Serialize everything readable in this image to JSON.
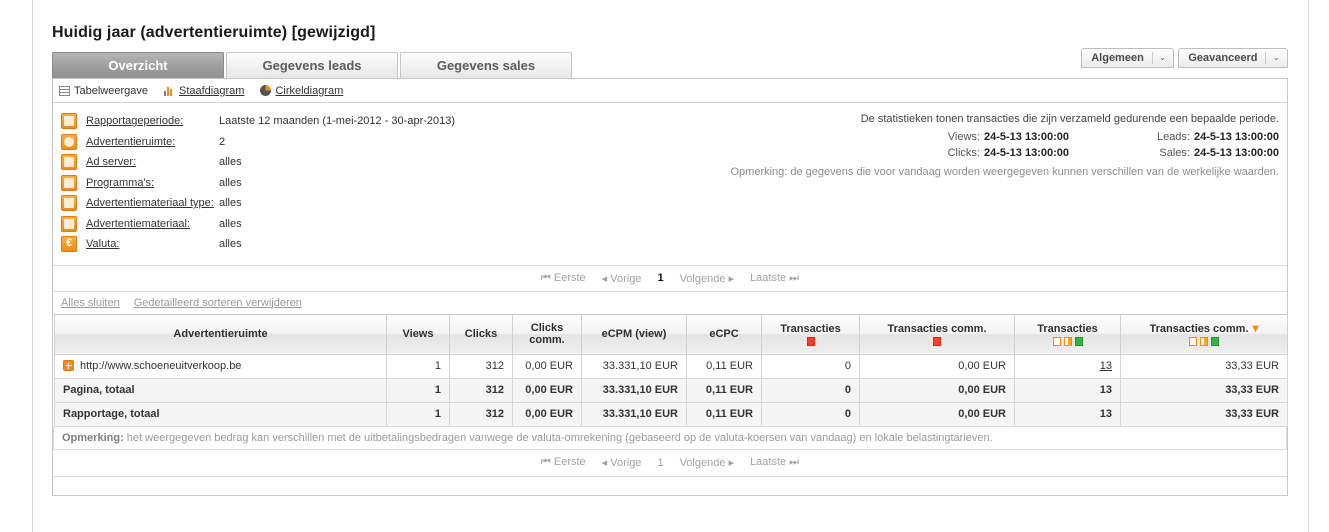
{
  "page": {
    "title": "Huidig jaar (advertentieruimte) [gewijzigd]"
  },
  "top_buttons": [
    {
      "label": "Algemeen",
      "arrow": "⌄"
    },
    {
      "label": "Geavanceerd",
      "arrow": "⌄"
    }
  ],
  "tabs": [
    {
      "label": "Overzicht",
      "active": true
    },
    {
      "label": "Gegevens leads",
      "active": false
    },
    {
      "label": "Gegevens sales",
      "active": false
    }
  ],
  "viewbar": [
    {
      "label": "Tabelweergave",
      "icon": "table-view-icon",
      "link": false
    },
    {
      "label": "Staafdiagram",
      "icon": "bar-chart-icon",
      "link": true
    },
    {
      "label": "Cirkeldiagram",
      "icon": "pie-chart-icon",
      "link": true
    }
  ],
  "filters": [
    {
      "icon": "calendar-icon",
      "label": "Rapportageperiode:",
      "value": "Laatste 12 maanden (1-mei-2012 - 30-apr-2013)"
    },
    {
      "icon": "ad-space-icon",
      "label": "Advertentieruimte:",
      "value": "2"
    },
    {
      "icon": "ad-server-icon",
      "label": "Ad server:",
      "value": "alles"
    },
    {
      "icon": "program-icon",
      "label": "Programma's:",
      "value": "alles"
    },
    {
      "icon": "creative-type-icon",
      "label": "Advertentiemateriaal type:",
      "value": "alles"
    },
    {
      "icon": "creative-icon",
      "label": "Advertentiemateriaal:",
      "value": "alles"
    },
    {
      "icon": "currency-icon",
      "label": "Valuta:",
      "value": "alles"
    }
  ],
  "info": {
    "headline": "De statistieken tonen transacties die zijn verzameld gedurende een bepaalde periode.",
    "stats": [
      {
        "label": "Views:",
        "value": "24-5-13 13:00:00"
      },
      {
        "label": "Leads:",
        "value": "24-5-13 13:00:00"
      },
      {
        "label": "Clicks:",
        "value": "24-5-13 13:00:00"
      },
      {
        "label": "Sales:",
        "value": "24-5-13 13:00:00"
      }
    ],
    "note": "Opmerking: de gegevens die voor vandaag worden weergegeven kunnen verschillen van de werkelijke waarden."
  },
  "pager": {
    "first": "Eerste",
    "previous": "Vorige",
    "current": "1",
    "next": "Volgende",
    "last": "Laatste"
  },
  "links": [
    {
      "label": "Alles sluiten"
    },
    {
      "label": "Gedetailleerd sorteren verwijderen"
    }
  ],
  "table": {
    "columns": [
      {
        "label": "Advertentieruimte",
        "icons": [],
        "sorted": false
      },
      {
        "label": "Views",
        "icons": [],
        "sorted": false
      },
      {
        "label": "Clicks",
        "icons": [],
        "sorted": false
      },
      {
        "label": "Clicks comm.",
        "icons": [],
        "sorted": false
      },
      {
        "label": "eCPM (view)",
        "icons": [],
        "sorted": false
      },
      {
        "label": "eCPC",
        "icons": [],
        "sorted": false
      },
      {
        "label": "Transacties",
        "icons": [
          "red"
        ],
        "sorted": false
      },
      {
        "label": "Transacties comm.",
        "icons": [
          "red"
        ],
        "sorted": false
      },
      {
        "label": "Transacties",
        "icons": [
          "open",
          "half",
          "green"
        ],
        "sorted": false
      },
      {
        "label": "Transacties comm.",
        "icons": [
          "open",
          "half",
          "green"
        ],
        "sorted": true
      }
    ],
    "rows": [
      {
        "type": "detail",
        "expandable": true,
        "name": "http://www.schoeneuitverkoop.be",
        "cells": [
          "1",
          "312",
          "0,00 EUR",
          "33.331,10 EUR",
          "0,11 EUR",
          "0",
          "0,00 EUR",
          "13",
          "33,33 EUR"
        ],
        "link_cell_index": 7
      },
      {
        "type": "total",
        "expandable": false,
        "name": "Pagina, totaal",
        "cells": [
          "1",
          "312",
          "0,00 EUR",
          "33.331,10 EUR",
          "0,11 EUR",
          "0",
          "0,00 EUR",
          "13",
          "33,33 EUR"
        ],
        "link_cell_index": -1
      },
      {
        "type": "total",
        "expandable": false,
        "name": "Rapportage, totaal",
        "cells": [
          "1",
          "312",
          "0,00 EUR",
          "33.331,10 EUR",
          "0,11 EUR",
          "0",
          "0,00 EUR",
          "13",
          "33,33 EUR"
        ],
        "link_cell_index": -1
      }
    ],
    "note_prefix": "Opmerking:",
    "note_text": " het weergegeven bedrag kan verschillen met de uitbetalingsbedragen vanwege de valuta-omrekening (gebaseerd op de valuta-koersen van vandaag) en lokale belastingtarieven."
  },
  "colors": {
    "accent": "#f08c1a",
    "tab_active_bg": "#9e9e9e",
    "status_red": "#f2412a",
    "status_green": "#37b13f",
    "panel_border": "#c8c8c8"
  }
}
